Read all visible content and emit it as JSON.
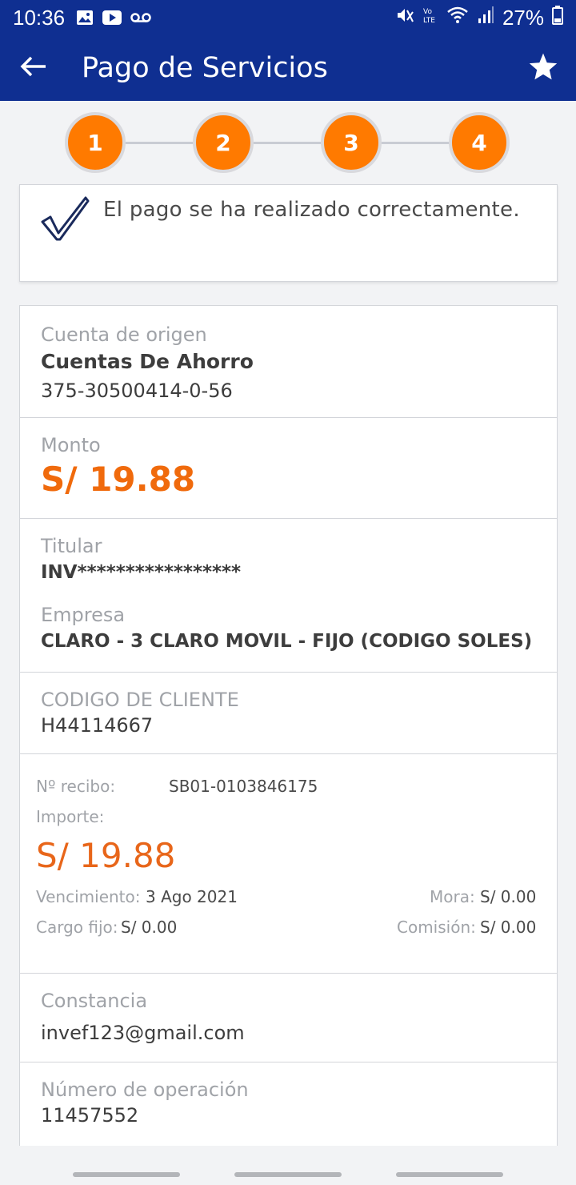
{
  "status_bar": {
    "time": "10:36",
    "battery": "27%",
    "icons": [
      "gallery-icon",
      "youtube-icon",
      "voicemail-icon",
      "mute-icon",
      "volte-icon",
      "wifi-icon",
      "signal-icon",
      "battery-icon"
    ]
  },
  "app_bar": {
    "title": "Pago de Servicios",
    "back_icon": "arrow-left-icon",
    "favorite_icon": "star-icon"
  },
  "stepper": {
    "steps": [
      "1",
      "2",
      "3",
      "4"
    ],
    "color": "#ff7a00"
  },
  "success": {
    "message": "El pago se ha realizado correctamente."
  },
  "details": {
    "origin_label": "Cuenta de origen",
    "origin_type": "Cuentas De Ahorro",
    "origin_number": "375-30500414-0-56",
    "amount_label": "Monto",
    "amount_value": "S/ 19.88",
    "holder_label": "Titular",
    "holder_value": "INV*****************",
    "company_label": "Empresa",
    "company_value": "CLARO - 3  CLARO MOVIL - FIJO (CODIGO SOLES)",
    "client_code_label": "CODIGO DE CLIENTE",
    "client_code_value": "H44114667",
    "receipt": {
      "number_label": "Nº recibo:",
      "number_value": "SB01-0103846175",
      "import_label": "Importe:",
      "import_value": "S/ 19.88",
      "due_label": "Vencimiento:",
      "due_value": "3 Ago 2021",
      "late_label": "Mora:",
      "late_value": "S/ 0.00",
      "fixed_label": "Cargo fijo:",
      "fixed_value": "S/ 0.00",
      "commission_label": "Comisión:",
      "commission_value": "S/ 0.00"
    },
    "proof_label": "Constancia",
    "proof_value": "invef123@gmail.com",
    "operation_label": "Número de operación",
    "operation_value": "11457552"
  },
  "colors": {
    "primary": "#0f2f91",
    "accent": "#f06a0c"
  }
}
